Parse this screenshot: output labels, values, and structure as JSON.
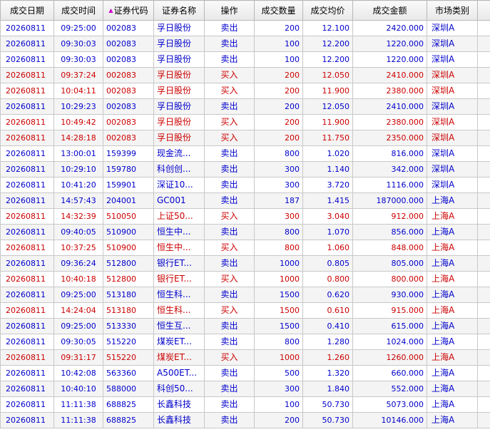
{
  "headers": {
    "date": "成交日期",
    "time": "成交时间",
    "code": "证券代码",
    "name": "证券名称",
    "op": "操作",
    "qty": "成交数量",
    "price": "成交均价",
    "amount": "成交金额",
    "market": "市场类别"
  },
  "rows": [
    {
      "date": "20260811",
      "time": "09:25:00",
      "code": "002083",
      "name": "孚日股份",
      "op": "卖出",
      "qty": "200",
      "price": "12.100",
      "amount": "2420.000",
      "market": "深圳A",
      "side": "sell"
    },
    {
      "date": "20260811",
      "time": "09:30:03",
      "code": "002083",
      "name": "孚日股份",
      "op": "卖出",
      "qty": "100",
      "price": "12.200",
      "amount": "1220.000",
      "market": "深圳A",
      "side": "sell"
    },
    {
      "date": "20260811",
      "time": "09:30:03",
      "code": "002083",
      "name": "孚日股份",
      "op": "卖出",
      "qty": "100",
      "price": "12.200",
      "amount": "1220.000",
      "market": "深圳A",
      "side": "sell"
    },
    {
      "date": "20260811",
      "time": "09:37:24",
      "code": "002083",
      "name": "孚日股份",
      "op": "买入",
      "qty": "200",
      "price": "12.050",
      "amount": "2410.000",
      "market": "深圳A",
      "side": "buy"
    },
    {
      "date": "20260811",
      "time": "10:04:11",
      "code": "002083",
      "name": "孚日股份",
      "op": "买入",
      "qty": "200",
      "price": "11.900",
      "amount": "2380.000",
      "market": "深圳A",
      "side": "buy"
    },
    {
      "date": "20260811",
      "time": "10:29:23",
      "code": "002083",
      "name": "孚日股份",
      "op": "卖出",
      "qty": "200",
      "price": "12.050",
      "amount": "2410.000",
      "market": "深圳A",
      "side": "sell"
    },
    {
      "date": "20260811",
      "time": "10:49:42",
      "code": "002083",
      "name": "孚日股份",
      "op": "买入",
      "qty": "200",
      "price": "11.900",
      "amount": "2380.000",
      "market": "深圳A",
      "side": "buy"
    },
    {
      "date": "20260811",
      "time": "14:28:18",
      "code": "002083",
      "name": "孚日股份",
      "op": "买入",
      "qty": "200",
      "price": "11.750",
      "amount": "2350.000",
      "market": "深圳A",
      "side": "buy"
    },
    {
      "date": "20260811",
      "time": "13:00:01",
      "code": "159399",
      "name": "现金流...",
      "op": "卖出",
      "qty": "800",
      "price": "1.020",
      "amount": "816.000",
      "market": "深圳A",
      "side": "sell"
    },
    {
      "date": "20260811",
      "time": "10:29:10",
      "code": "159780",
      "name": "科创创...",
      "op": "卖出",
      "qty": "300",
      "price": "1.140",
      "amount": "342.000",
      "market": "深圳A",
      "side": "sell"
    },
    {
      "date": "20260811",
      "time": "10:41:20",
      "code": "159901",
      "name": "深证10...",
      "op": "卖出",
      "qty": "300",
      "price": "3.720",
      "amount": "1116.000",
      "market": "深圳A",
      "side": "sell"
    },
    {
      "date": "20260811",
      "time": "14:57:43",
      "code": "204001",
      "name": "GC001",
      "op": "卖出",
      "qty": "187",
      "price": "1.415",
      "amount": "187000.000",
      "market": "上海A",
      "side": "sell"
    },
    {
      "date": "20260811",
      "time": "14:32:39",
      "code": "510050",
      "name": "上证50...",
      "op": "买入",
      "qty": "300",
      "price": "3.040",
      "amount": "912.000",
      "market": "上海A",
      "side": "buy"
    },
    {
      "date": "20260811",
      "time": "09:40:05",
      "code": "510900",
      "name": "恒生中...",
      "op": "卖出",
      "qty": "800",
      "price": "1.070",
      "amount": "856.000",
      "market": "上海A",
      "side": "sell"
    },
    {
      "date": "20260811",
      "time": "10:37:25",
      "code": "510900",
      "name": "恒生中...",
      "op": "买入",
      "qty": "800",
      "price": "1.060",
      "amount": "848.000",
      "market": "上海A",
      "side": "buy"
    },
    {
      "date": "20260811",
      "time": "09:36:24",
      "code": "512800",
      "name": "银行ET...",
      "op": "卖出",
      "qty": "1000",
      "price": "0.805",
      "amount": "805.000",
      "market": "上海A",
      "side": "sell"
    },
    {
      "date": "20260811",
      "time": "10:40:18",
      "code": "512800",
      "name": "银行ET...",
      "op": "买入",
      "qty": "1000",
      "price": "0.800",
      "amount": "800.000",
      "market": "上海A",
      "side": "buy"
    },
    {
      "date": "20260811",
      "time": "09:25:00",
      "code": "513180",
      "name": "恒生科...",
      "op": "卖出",
      "qty": "1500",
      "price": "0.620",
      "amount": "930.000",
      "market": "上海A",
      "side": "sell"
    },
    {
      "date": "20260811",
      "time": "14:24:04",
      "code": "513180",
      "name": "恒生科...",
      "op": "买入",
      "qty": "1500",
      "price": "0.610",
      "amount": "915.000",
      "market": "上海A",
      "side": "buy"
    },
    {
      "date": "20260811",
      "time": "09:25:00",
      "code": "513330",
      "name": "恒生互...",
      "op": "卖出",
      "qty": "1500",
      "price": "0.410",
      "amount": "615.000",
      "market": "上海A",
      "side": "sell"
    },
    {
      "date": "20260811",
      "time": "09:30:05",
      "code": "515220",
      "name": "煤炭ET...",
      "op": "卖出",
      "qty": "800",
      "price": "1.280",
      "amount": "1024.000",
      "market": "上海A",
      "side": "sell"
    },
    {
      "date": "20260811",
      "time": "09:31:17",
      "code": "515220",
      "name": "煤炭ET...",
      "op": "买入",
      "qty": "1000",
      "price": "1.260",
      "amount": "1260.000",
      "market": "上海A",
      "side": "buy"
    },
    {
      "date": "20260811",
      "time": "10:42:08",
      "code": "563360",
      "name": "A500ET...",
      "op": "卖出",
      "qty": "500",
      "price": "1.320",
      "amount": "660.000",
      "market": "上海A",
      "side": "sell"
    },
    {
      "date": "20260811",
      "time": "10:40:10",
      "code": "588000",
      "name": "科创50...",
      "op": "卖出",
      "qty": "300",
      "price": "1.840",
      "amount": "552.000",
      "market": "上海A",
      "side": "sell"
    },
    {
      "date": "20260811",
      "time": "11:11:38",
      "code": "688825",
      "name": "长鑫科技",
      "op": "卖出",
      "qty": "100",
      "price": "50.730",
      "amount": "5073.000",
      "market": "上海A",
      "side": "sell"
    },
    {
      "date": "20260811",
      "time": "11:11:38",
      "code": "688825",
      "name": "长鑫科技",
      "op": "卖出",
      "qty": "200",
      "price": "50.730",
      "amount": "10146.000",
      "market": "上海A",
      "side": "sell"
    }
  ]
}
